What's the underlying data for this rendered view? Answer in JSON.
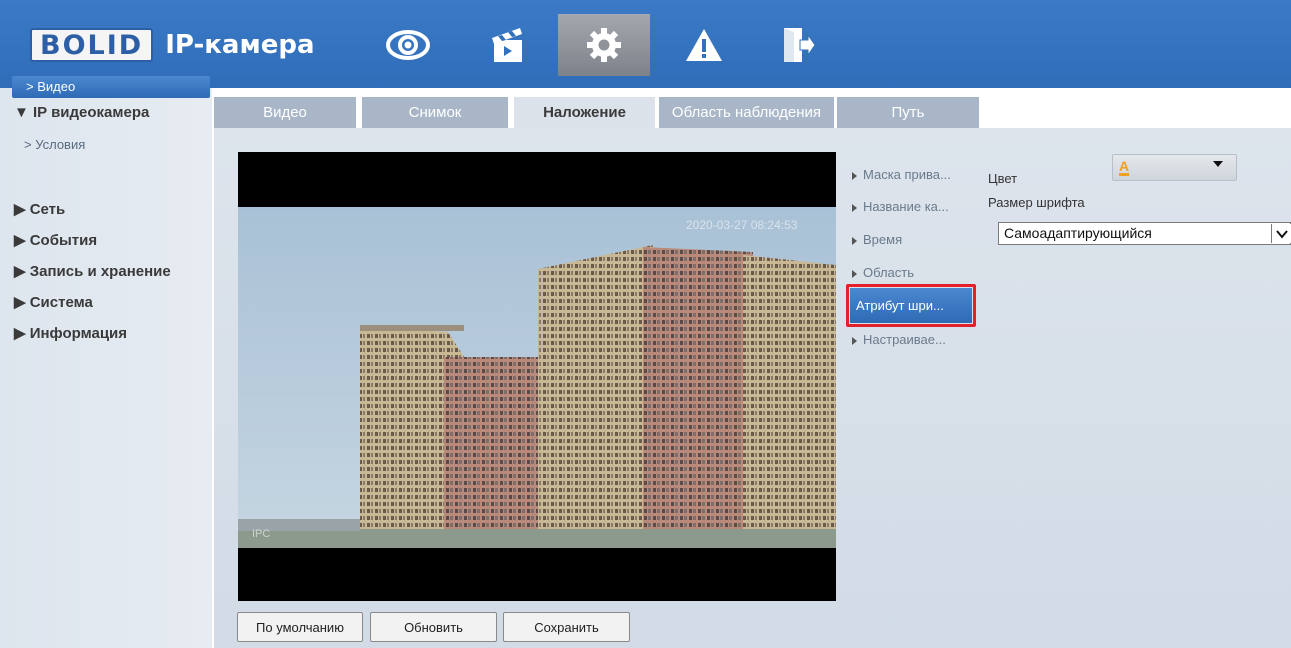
{
  "header": {
    "logo_text": "BOLID",
    "app_title": "IP-камера",
    "nav": [
      {
        "icon": "eye-icon"
      },
      {
        "icon": "clapperboard-icon"
      },
      {
        "icon": "gear-icon"
      },
      {
        "icon": "alarm-icon"
      },
      {
        "icon": "logout-icon"
      }
    ]
  },
  "sidebar": {
    "ip_camera": "▼ IP видеокамера",
    "conditions": "> Условия",
    "video": "> Видео",
    "network": "▶ Сеть",
    "events": "▶ События",
    "storage": "▶ Запись и хранение",
    "system": "▶ Система",
    "info": "▶ Информация"
  },
  "tabs": {
    "video": "Видео",
    "snapshot": "Снимок",
    "overlay": "Наложение",
    "area": "Область наблюдения",
    "path": "Путь"
  },
  "preview": {
    "timestamp": "2020-03-27 08:24:53",
    "channel": "IPC"
  },
  "buttons": {
    "default": "По умолчанию",
    "refresh": "Обновить",
    "save": "Сохранить"
  },
  "overlay_menu": {
    "privacy_mask": "Маска прива...",
    "channel_name": "Название ка...",
    "time": "Время",
    "area": "Область",
    "font_attr": "Атрибут шри...",
    "custom": "Настраивае..."
  },
  "settings": {
    "color_label": "Цвет",
    "color_value": "A",
    "font_size_label": "Размер шрифта",
    "font_size_value": "Самоадаптирующийся"
  },
  "colors": {
    "header_blue": "#3070bd",
    "selected_blue": "#3a7ac4",
    "highlight_red": "#e4202a",
    "color_swatch": "#f0a020"
  }
}
